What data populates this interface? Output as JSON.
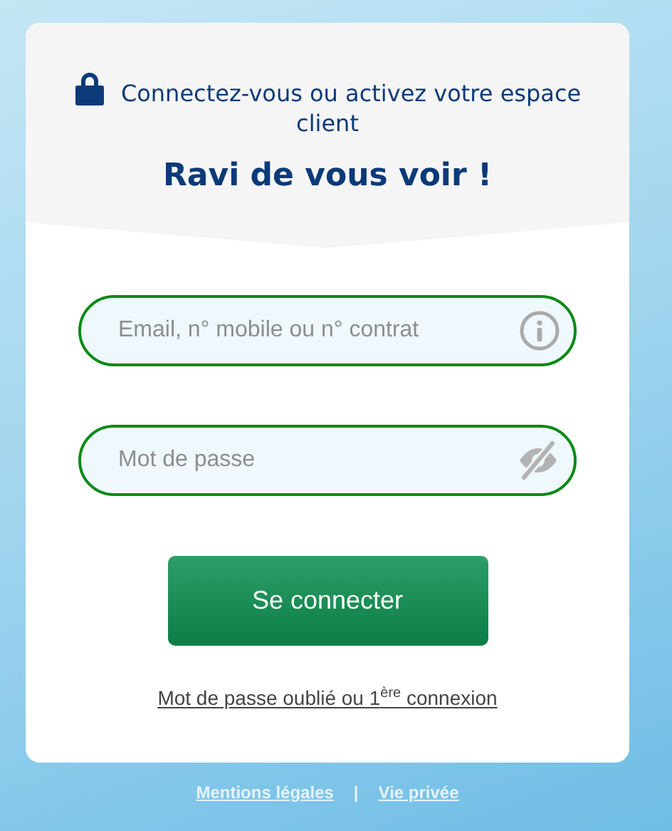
{
  "header": {
    "intro": "Connectez-vous ou activez votre espace client",
    "title": "Ravi de vous voir !"
  },
  "fields": [
    {
      "kind": "text",
      "placeholder": "Email, n° mobile ou n° contrat"
    },
    {
      "kind": "password",
      "placeholder": "Mot de passe"
    }
  ],
  "submit": "Se connecter",
  "forgot_link": "Mot de passe oublié ou 1$^{ère}$ connexion",
  "footer": {
    "links": [
      "Mentions légales",
      "Vie privée"
    ],
    "separator": "|"
  }
}
